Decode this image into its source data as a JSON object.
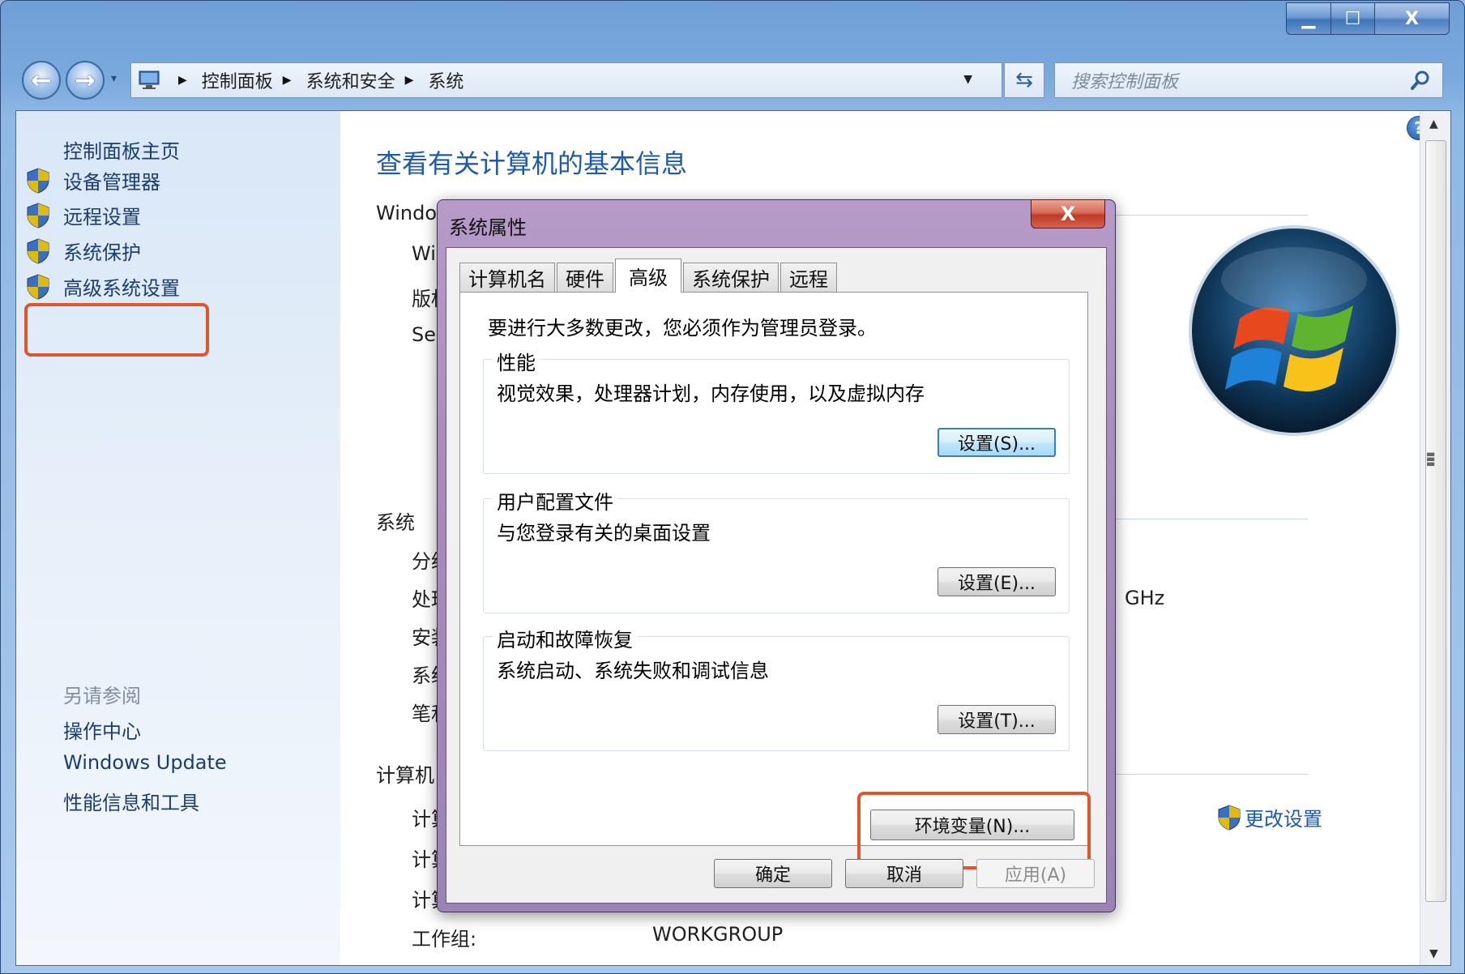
{
  "window": {
    "caption_buttons": {
      "minimize": "▁",
      "maximize": "☐",
      "close": "X"
    }
  },
  "address": {
    "crumbs": [
      "控制面板",
      "系统和安全",
      "系统"
    ],
    "search_placeholder": "搜索控制面板"
  },
  "left_pane": {
    "home": "控制面板主页",
    "items": [
      "设备管理器",
      "远程设置",
      "系统保护",
      "高级系统设置"
    ],
    "see_also_title": "另请参阅",
    "see_also": [
      "操作中心",
      "Windows Update",
      "性能信息和工具"
    ]
  },
  "main": {
    "title": "查看有关计算机的基本信息",
    "windows_section": "Windo",
    "windows_rows": [
      "Wi",
      "版权",
      "Ser"
    ],
    "system_section": "系统",
    "system_rows": [
      "分级",
      "处理",
      "安装",
      "系统",
      "笔和"
    ],
    "processor_suffix": "GHz",
    "computer_section": "计算机",
    "computer_rows": [
      "计算",
      "计算",
      "计算"
    ],
    "workgroup_label": "工作组:",
    "workgroup_value": "WORKGROUP",
    "change_settings": "更改设置"
  },
  "dialog": {
    "title": "系统属性",
    "close": "X",
    "tabs": [
      "计算机名",
      "硬件",
      "高级",
      "系统保护",
      "远程"
    ],
    "active_tab": "高级",
    "admin_note": "要进行大多数更改，您必须作为管理员登录。",
    "groups": [
      {
        "title": "性能",
        "desc": "视觉效果，处理器计划，内存使用，以及虚拟内存",
        "button": "设置(S)..."
      },
      {
        "title": "用户配置文件",
        "desc": "与您登录有关的桌面设置",
        "button": "设置(E)..."
      },
      {
        "title": "启动和故障恢复",
        "desc": "系统启动、系统失败和调试信息",
        "button": "设置(T)..."
      }
    ],
    "env_button": "环境变量(N)...",
    "ok": "确定",
    "cancel": "取消",
    "apply": "应用(A)"
  },
  "colors": {
    "accent_link": "#1e5aa8",
    "highlight_box": "#e0562c",
    "dialog_frame": "#a78bbd"
  }
}
